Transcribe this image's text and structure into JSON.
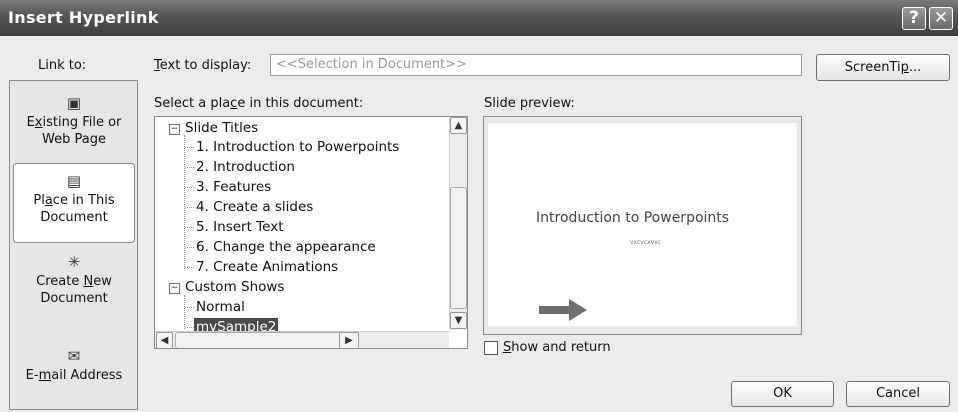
{
  "window": {
    "title": "Insert Hyperlink",
    "help_glyph": "?",
    "close_glyph": "✕"
  },
  "link_to": {
    "label": "Link to:",
    "items": [
      {
        "pre": "E",
        "u": "x",
        "post": "isting File or",
        "line2": "Web Page",
        "icon": "file-icon"
      },
      {
        "pre": "Pl",
        "u": "a",
        "post": "ce in This",
        "line2": "Document",
        "icon": "document-place-icon"
      },
      {
        "pre": "Create ",
        "u": "N",
        "post": "ew",
        "line2": "Document",
        "icon": "new-document-icon"
      },
      {
        "pre": "E-",
        "u": "m",
        "post": "ail Address",
        "line2": "",
        "icon": "email-icon"
      }
    ]
  },
  "text_to_display": {
    "label_u": "T",
    "label_rest": "ext to display:",
    "value": "<<Selection in Document>>"
  },
  "screentip": {
    "pre": "ScreenTi",
    "u": "p",
    "post": "..."
  },
  "place_label": {
    "pre": "Select a pla",
    "u": "c",
    "post": "e in this document:"
  },
  "tree": {
    "group1": "Slide Titles",
    "slides": [
      "1. Introduction to Powerpoints",
      "2. Introduction",
      "3. Features",
      "4. Create a slides",
      "5. Insert Text",
      "6. Change the appearance",
      "7. Create Animations"
    ],
    "group2": "Custom Shows",
    "shows": [
      "Normal",
      "mySample2"
    ],
    "selected": "mySample2"
  },
  "preview": {
    "label": "Slide preview:",
    "slide_title": "Introduction  to Powerpoints",
    "slide_subtitle": "vxcvcxvxc"
  },
  "show_and_return": {
    "u": "S",
    "rest": "how and return",
    "checked": false
  },
  "buttons": {
    "ok": "OK",
    "cancel": "Cancel"
  }
}
